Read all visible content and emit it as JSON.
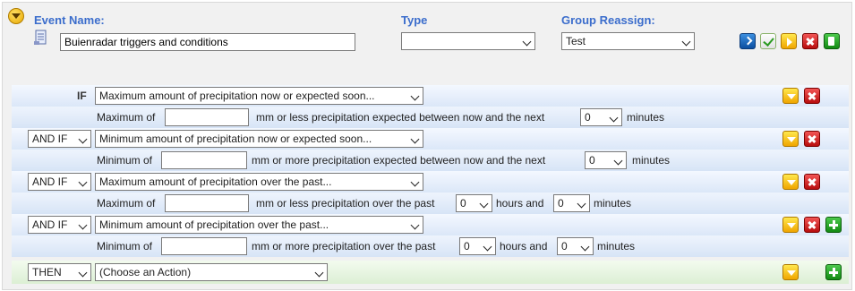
{
  "header": {
    "event_name_label": "Event Name:",
    "event_name_value": "Buienradar triggers and conditions",
    "type_label": "Type",
    "type_value": "",
    "group_reassign_label": "Group Reassign:",
    "group_reassign_value": "Test"
  },
  "conditions": [
    {
      "prefix": "IF",
      "condition": "Maximum amount of precipitation now or expected soon...",
      "detail": {
        "pre": "Maximum of",
        "amount_value": "",
        "mid": "mm or less precipitation expected between now and the next",
        "minutes_value": "0",
        "post": "minutes"
      }
    },
    {
      "prefix": "AND IF",
      "condition": "Minimum amount of precipitation now or expected soon...",
      "detail": {
        "pre": "Minimum of",
        "amount_value": "",
        "mid": "mm or more precipitation expected between now and the next",
        "minutes_value": "0",
        "post": "minutes"
      }
    },
    {
      "prefix": "AND IF",
      "condition": "Maximum amount of precipitation over the past...",
      "detail": {
        "pre": "Maximum of",
        "amount_value": "",
        "mid": "mm or less precipitation over the past",
        "hours_value": "0",
        "hours_label": "hours and",
        "minutes_value": "0",
        "post": "minutes"
      }
    },
    {
      "prefix": "AND IF",
      "condition": "Minimum amount of precipitation over the past...",
      "detail": {
        "pre": "Minimum of",
        "amount_value": "",
        "mid": "mm or more precipitation over the past",
        "hours_value": "0",
        "hours_label": "hours and",
        "minutes_value": "0",
        "post": "minutes"
      }
    }
  ],
  "action": {
    "prefix": "THEN",
    "value": "(Choose an Action)"
  },
  "icons": {
    "collapse": "chevron-down-icon",
    "document": "document-icon",
    "go": "arrow-right-icon",
    "save": "checkmark-icon",
    "run": "play-icon",
    "delete": "close-icon",
    "export": "export-icon",
    "add": "plus-icon"
  },
  "colors": {
    "label_blue": "#3b6dcc",
    "condition_row": "#dbe7f8",
    "action_row": "#dcefd4",
    "delete_red": "#c41a1a",
    "add_green": "#1a9a1a",
    "move_yellow": "#f0a500"
  }
}
